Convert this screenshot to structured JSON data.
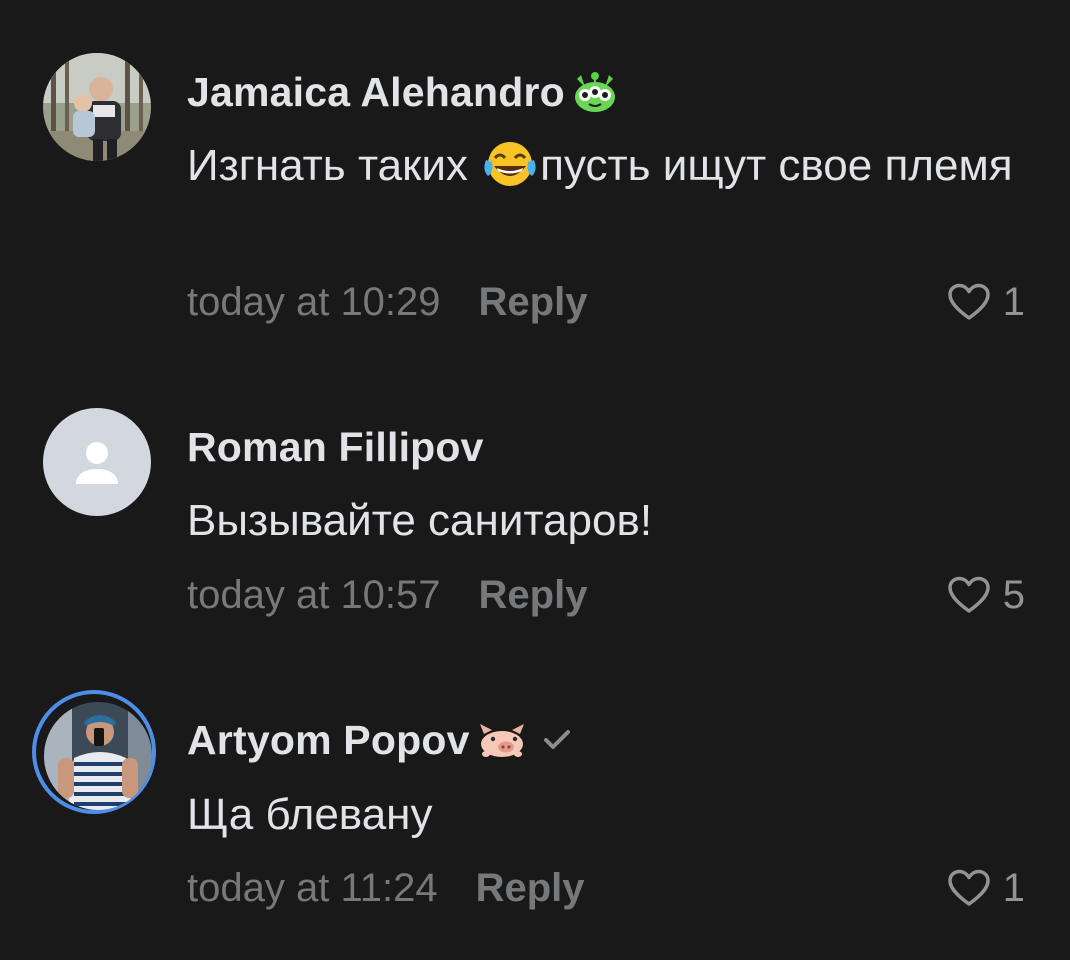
{
  "comments": [
    {
      "author": "Jamaica Alehandro",
      "author_emoji": "alien-cat-emoji",
      "text_before_emoji": "Изгнать таких ",
      "inline_emoji": "tears-of-joy-emoji",
      "text_after_emoji": "пусть ищут свое племя",
      "time": "today at 10:29",
      "reply_label": "Reply",
      "likes": "1"
    },
    {
      "author": "Roman Fillipov",
      "text": "Вызывайте санитаров!",
      "time": "today at 10:57",
      "reply_label": "Reply",
      "likes": "5"
    },
    {
      "author": "Artyom Popov",
      "author_emoji": "pig-emoji",
      "verified": true,
      "text": "Ща блевану",
      "time": "today at 11:24",
      "reply_label": "Reply",
      "likes": "1"
    }
  ],
  "colors": {
    "background": "#19191a",
    "text_primary": "#e1e3e6",
    "text_secondary": "#76787a",
    "story_ring": "#4d8fe8",
    "placeholder_avatar_bg": "#d3d8e0"
  }
}
